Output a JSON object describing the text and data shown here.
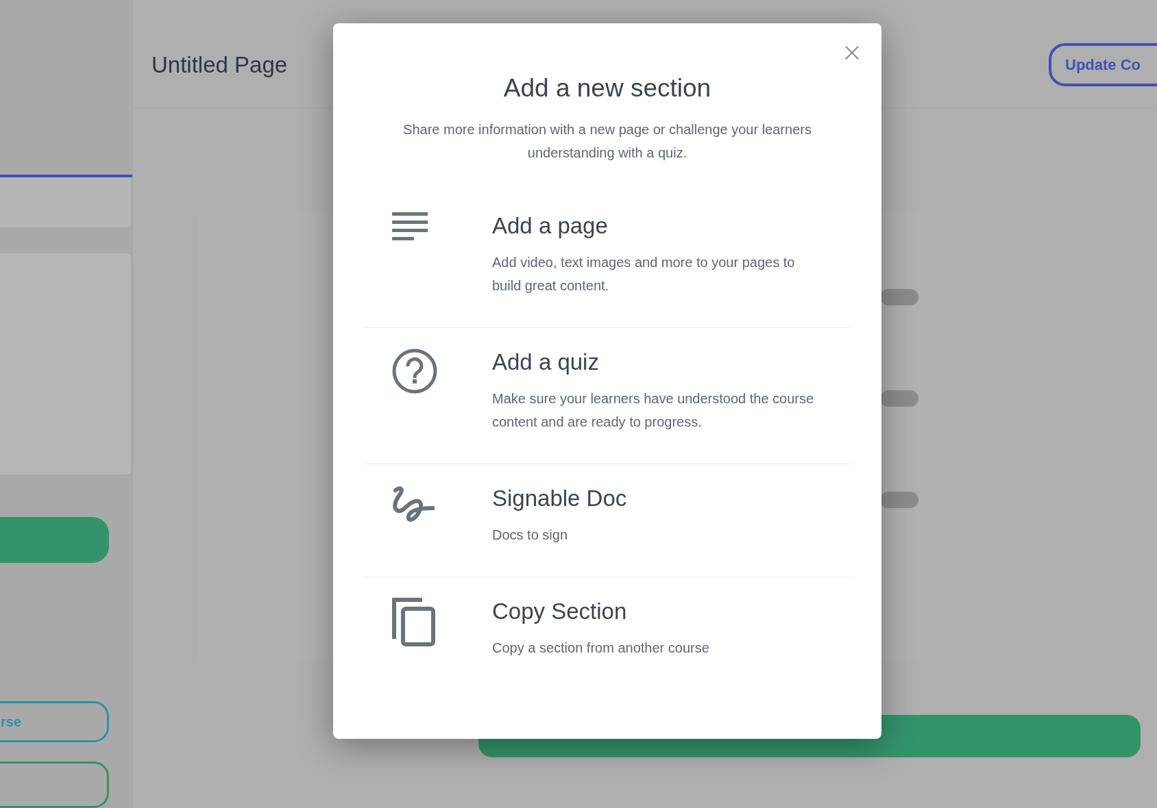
{
  "sidebar": {
    "outline_button": {
      "label": "rse"
    }
  },
  "header": {
    "title": "Untitled Page",
    "button": "Update Co"
  },
  "modal": {
    "title": "Add a new section",
    "subtitle": "Share more information with a new page or challenge your learners understanding with a quiz.",
    "options": [
      {
        "kind": "page",
        "title": "Add a page",
        "description": "Add video, text images and more to your pages to build great content."
      },
      {
        "kind": "quiz",
        "title": "Add a quiz",
        "description": "Make sure your learners have understood the course content and are ready to progress."
      },
      {
        "kind": "signature",
        "title": "Signable Doc",
        "description": "Docs to sign"
      },
      {
        "kind": "copy",
        "title": "Copy Section",
        "description": "Copy a section from another course"
      }
    ]
  }
}
